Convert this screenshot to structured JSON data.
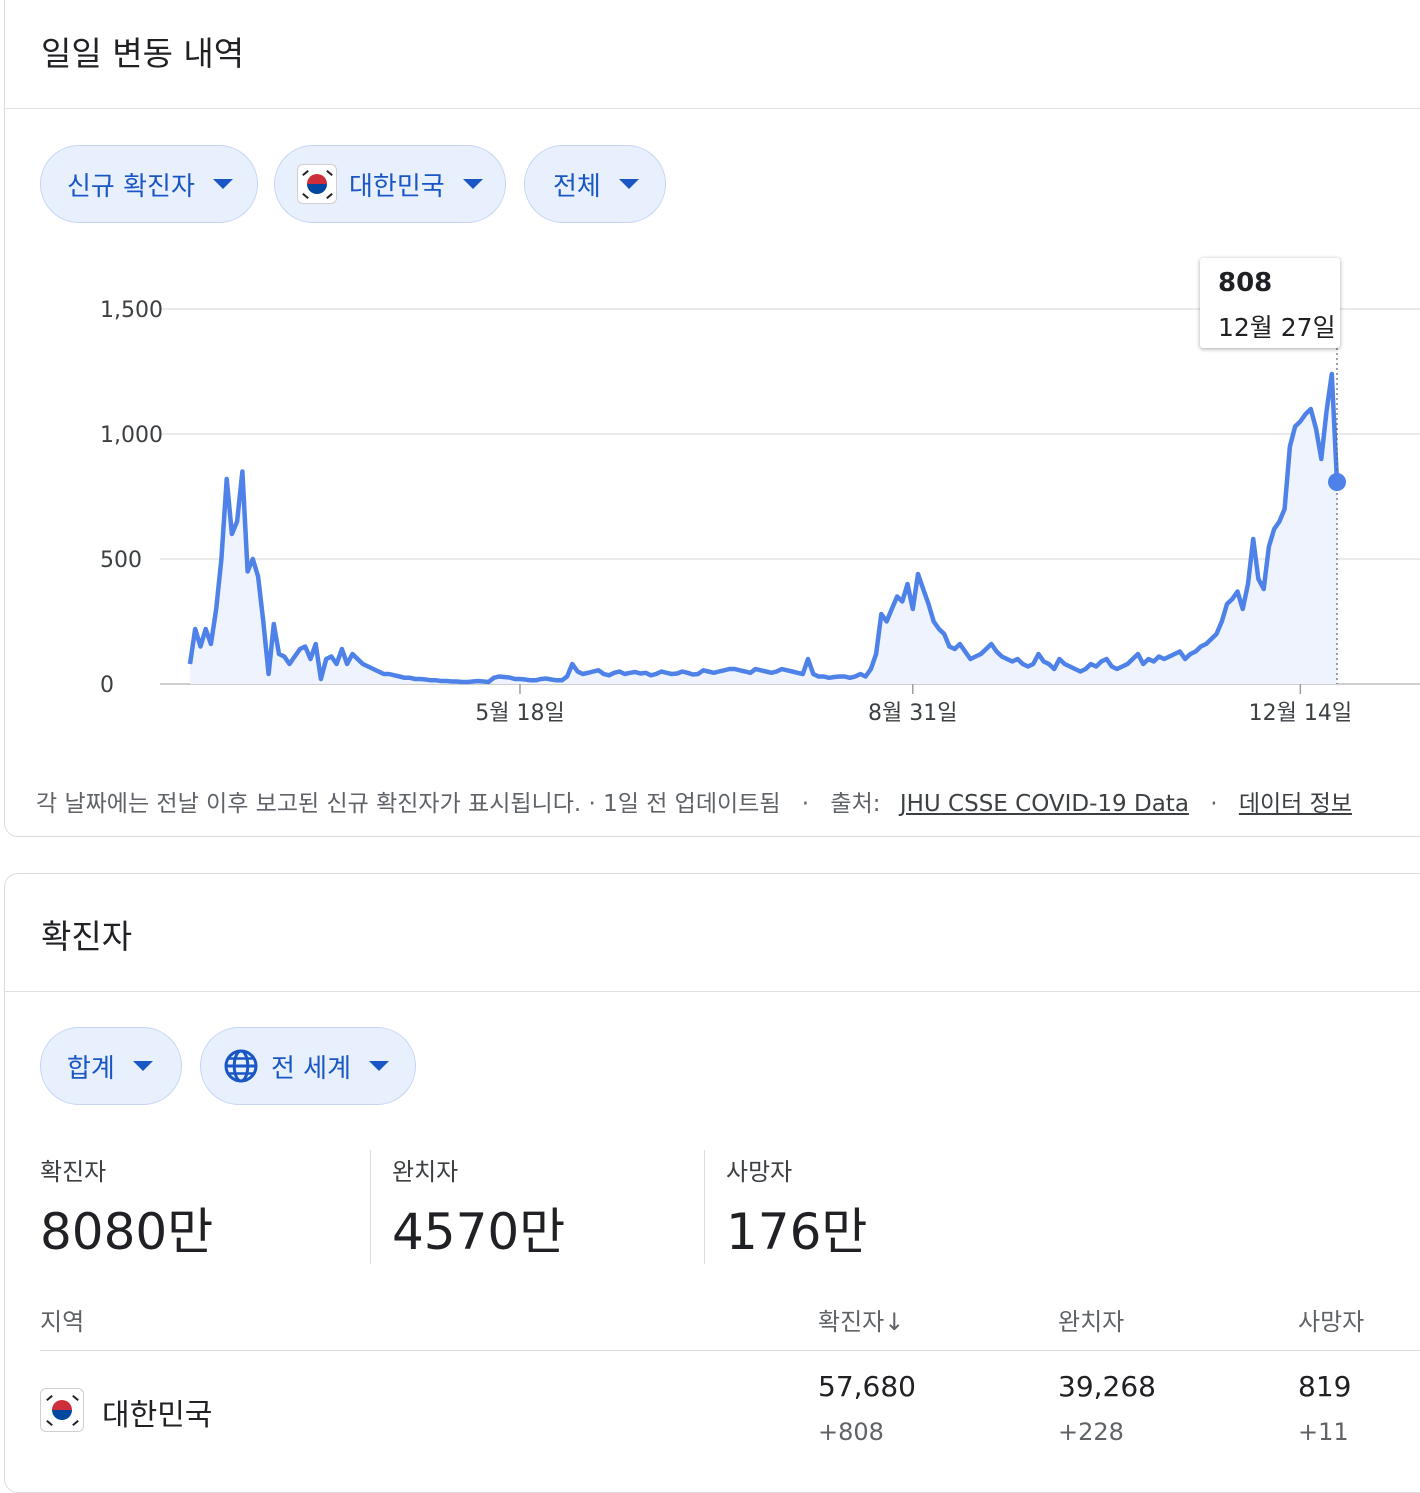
{
  "daily_card": {
    "title": "일일 변동 내역",
    "chips": {
      "metric": "신규 확진자",
      "country": "대한민국",
      "range": "전체"
    },
    "tooltip": {
      "value": "808",
      "date": "12월 27일"
    },
    "footer": {
      "note": "각 날짜에는 전날 이후 보고된 신규 확진자가 표시됩니다. · 1일 전 업데이트됨",
      "sep1": "·",
      "source_label": "출처:",
      "source_link": "JHU CSSE COVID-19 Data",
      "sep2": "·",
      "info_link": "데이터 정보"
    }
  },
  "chart_data": {
    "type": "area",
    "title": "",
    "xlabel": "",
    "ylabel": "",
    "ylim": [
      0,
      1500
    ],
    "y_ticks": [
      "0",
      "500",
      "1,000",
      "1,500"
    ],
    "x_ticks": [
      "5월 18일",
      "8월 31일",
      "12월 14일"
    ],
    "grid": true,
    "line_color": "#4f82e8",
    "series": [
      {
        "values": [
          80,
          220,
          150,
          220,
          160,
          300,
          500,
          820,
          600,
          650,
          850,
          450,
          500,
          430,
          250,
          40,
          240,
          120,
          110,
          80,
          110,
          140,
          150,
          100,
          160,
          20,
          100,
          110,
          80,
          140,
          80,
          120,
          100,
          80,
          70,
          60,
          50,
          40,
          40,
          35,
          30,
          25,
          25,
          20,
          20,
          18,
          15,
          15,
          12,
          12,
          10,
          10,
          8,
          8,
          10,
          12,
          10,
          8,
          25,
          30,
          28,
          26,
          20,
          20,
          18,
          15,
          15,
          20,
          22,
          18,
          15,
          15,
          30,
          80,
          50,
          40,
          45,
          50,
          55,
          40,
          35,
          45,
          50,
          40,
          45,
          48,
          42,
          45,
          35,
          40,
          50,
          45,
          40,
          42,
          50,
          45,
          38,
          40,
          55,
          50,
          45,
          50,
          55,
          60,
          60,
          55,
          50,
          45,
          60,
          55,
          50,
          45,
          50,
          60,
          55,
          50,
          45,
          40,
          100,
          40,
          30,
          30,
          25,
          28,
          30,
          30,
          25,
          30,
          40,
          30,
          60,
          120,
          280,
          250,
          300,
          350,
          330,
          400,
          300,
          440,
          380,
          320,
          250,
          220,
          200,
          150,
          140,
          160,
          130,
          100,
          110,
          120,
          140,
          160,
          130,
          110,
          100,
          90,
          100,
          80,
          70,
          80,
          120,
          90,
          80,
          60,
          100,
          80,
          70,
          60,
          50,
          60,
          80,
          70,
          90,
          100,
          70,
          60,
          70,
          80,
          100,
          120,
          80,
          100,
          90,
          110,
          100,
          110,
          120,
          130,
          100,
          120,
          130,
          150,
          160,
          180,
          200,
          250,
          320,
          340,
          370,
          300,
          400,
          580,
          420,
          380,
          550,
          620,
          650,
          700,
          950,
          1030,
          1050,
          1080,
          1100,
          1020,
          900,
          1090,
          1240,
          808
        ]
      }
    ],
    "last_point": {
      "date": "12월 27일",
      "value": 808
    }
  },
  "totals_card": {
    "title": "확진자",
    "chips": {
      "measure": "합계",
      "region": "전 세계"
    },
    "stats": [
      {
        "label": "확진자",
        "value": "8080만"
      },
      {
        "label": "완치자",
        "value": "4570만"
      },
      {
        "label": "사망자",
        "value": "176만"
      }
    ],
    "table": {
      "headers": {
        "region": "지역",
        "cases": "확진자↓",
        "recovered": "완치자",
        "deaths": "사망자"
      },
      "rows": [
        {
          "region": "대한민국",
          "cases": "57,680",
          "cases_delta": "+808",
          "recovered": "39,268",
          "recovered_delta": "+228",
          "deaths": "819",
          "deaths_delta": "+11"
        }
      ]
    }
  },
  "colors": {
    "accent": "#1a56c4",
    "chip_bg": "#e8f0fe",
    "line": "#4f82e8"
  }
}
